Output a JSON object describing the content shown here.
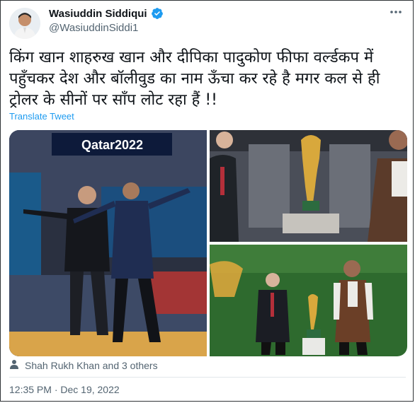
{
  "author": {
    "name": "Wasiuddin Siddiqui",
    "handle": "@WasiuddinSiddi1"
  },
  "tweet": {
    "text": "किंग खान शाहरुख खान और दीपिका पादुकोण फीफा वर्ल्डकप में पहुँचकर देश और बॉलीवुड का नाम ऊँचा कर रहे है मगर कल से ही ट्रोलर के सीनों पर साँप लोट रहा हैं !!",
    "translate_label": "Translate Tweet"
  },
  "media": {
    "photo1": {
      "banner_text": "Qatar2022"
    }
  },
  "tagged": {
    "text": "Shah Rukh Khan and 3 others"
  },
  "meta": {
    "timestamp": "12:35 PM · Dec 19, 2022"
  },
  "colors": {
    "link": "#1d9bf0",
    "verified": "#1d9bf0",
    "secondary": "#536471"
  },
  "icons": {
    "verified": "verified-badge-icon",
    "more": "more-options-icon",
    "tag": "person-tag-icon"
  }
}
